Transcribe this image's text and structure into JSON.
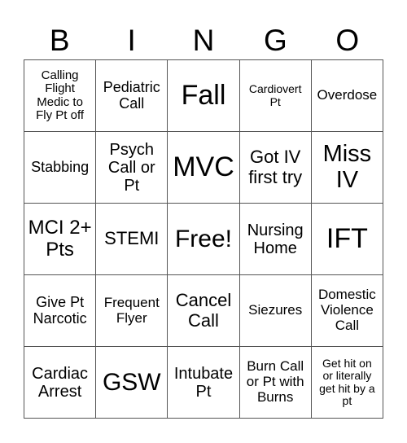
{
  "header": [
    "B",
    "I",
    "N",
    "G",
    "O"
  ],
  "cells": [
    [
      "Calling Flight Medic to Fly Pt off",
      "Pediatric Call",
      "Fall",
      "Cardiovert Pt",
      "Overdose"
    ],
    [
      "Stabbing",
      "Psych Call or Pt",
      "MVC",
      "Got IV first try",
      "Miss IV"
    ],
    [
      "MCI 2+ Pts",
      "STEMI",
      "Free!",
      "Nursing Home",
      "IFT"
    ],
    [
      "Give Pt Narcotic",
      "Frequent Flyer",
      "Cancel Call",
      "Siezures",
      "Domestic Violence Call"
    ],
    [
      "Cardiac Arrest",
      "GSW",
      "Intubate Pt",
      "Burn Call or Pt with Burns",
      "Get hit on or literally get hit by a pt"
    ]
  ]
}
